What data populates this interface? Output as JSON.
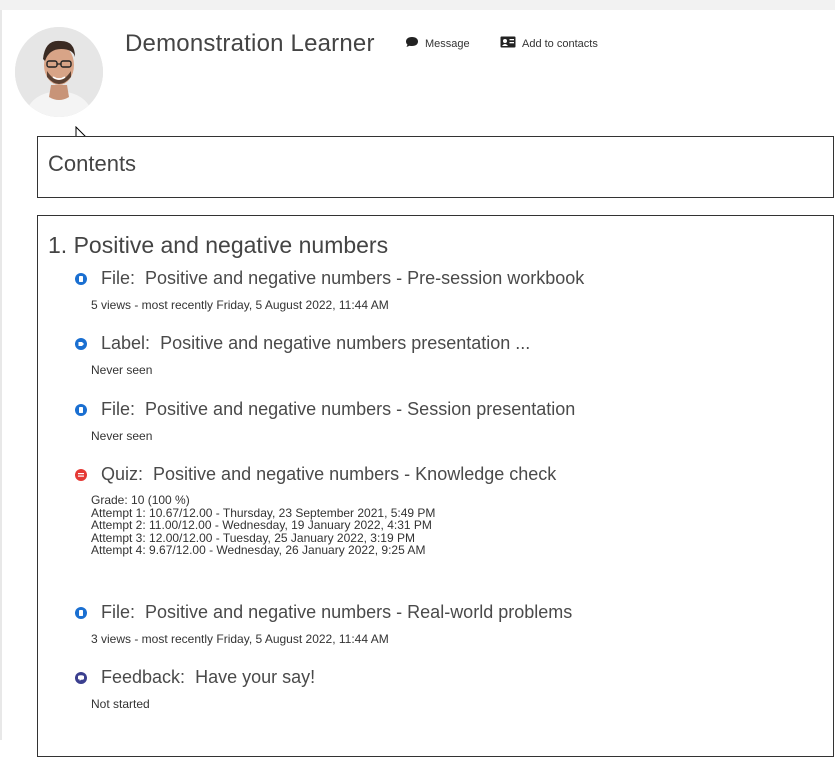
{
  "user": {
    "name": "Demonstration Learner",
    "message_label": "Message",
    "contacts_label": "Add to contacts"
  },
  "contents_title": "Contents",
  "section": {
    "title": "1. Positive and negative numbers",
    "activities": [
      {
        "type": "File:",
        "name": "Positive and negative numbers - Pre-session workbook",
        "icon": "file-icon",
        "color": "#1a6fd1",
        "details": [
          "5 views - most recently Friday, 5 August 2022, 11:44 AM"
        ]
      },
      {
        "type": "Label:",
        "name": "Positive and negative numbers presentation ...",
        "icon": "label-icon",
        "color": "#1a6fd1",
        "details": [
          "Never seen"
        ]
      },
      {
        "type": "File:",
        "name": "Positive and negative numbers - Session presentation",
        "icon": "file-icon",
        "color": "#1a6fd1",
        "details": [
          "Never seen"
        ]
      },
      {
        "type": "Quiz:",
        "name": "Positive and negative numbers - Knowledge check",
        "icon": "quiz-icon",
        "color": "#e53935",
        "details": [
          "Grade: 10 (100 %)",
          "Attempt 1: 10.67/12.00 - Thursday, 23 September 2021, 5:49 PM",
          "Attempt 2: 11.00/12.00 - Wednesday, 19 January 2022, 4:31 PM",
          "Attempt 3: 12.00/12.00 - Tuesday, 25 January 2022, 3:19 PM",
          "Attempt 4: 9.67/12.00 - Wednesday, 26 January 2022, 9:25 AM"
        ]
      },
      {
        "type": "File:",
        "name": "Positive and negative numbers - Real-world problems",
        "icon": "file-icon",
        "color": "#1a6fd1",
        "details": [
          "3 views - most recently Friday, 5 August 2022, 11:44 AM"
        ]
      },
      {
        "type": "Feedback:",
        "name": "Have your say!",
        "icon": "feedback-icon",
        "color": "#3b3f8f",
        "details": [
          "Not started"
        ]
      }
    ]
  }
}
